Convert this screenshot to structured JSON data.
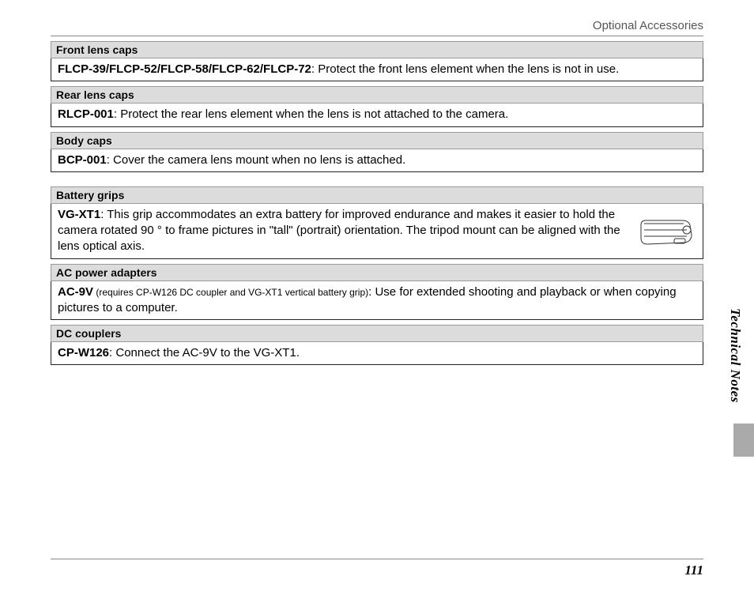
{
  "header": {
    "title": "Optional Accessories"
  },
  "sections": [
    {
      "title": "Front lens caps",
      "lead": "FLCP-39/FLCP-52/FLCP-58/FLCP-62/FLCP-72",
      "body": ": Protect the front lens element when the lens is not in use."
    },
    {
      "title": "Rear lens caps",
      "lead": "RLCP-001",
      "body": ": Protect the rear lens element when the lens is not attached to the camera."
    },
    {
      "title": "Body caps",
      "lead": "BCP-001",
      "body": ": Cover the camera lens mount when no lens is attached."
    },
    {
      "title": "Battery grips",
      "lead": "VG-XT1",
      "body": ": This grip accommodates an extra battery for improved endurance and makes it easier to hold the camera rotated 90 ° to frame pictures in \"tall\" (portrait) orientation. The tripod mount can be aligned with the lens optical axis.",
      "has_illustration": true
    },
    {
      "title": "AC power adapters",
      "lead": "AC-9V",
      "note": " (requires CP-W126 DC coupler and VG-XT1 vertical battery grip)",
      "body": ": Use for extended shooting and playback or when copying pictures to a computer."
    },
    {
      "title": "DC couplers",
      "lead": "CP-W126",
      "body": ": Connect the AC-9V to the VG-XT1."
    }
  ],
  "side_label": "Technical Notes",
  "page_number": "111"
}
